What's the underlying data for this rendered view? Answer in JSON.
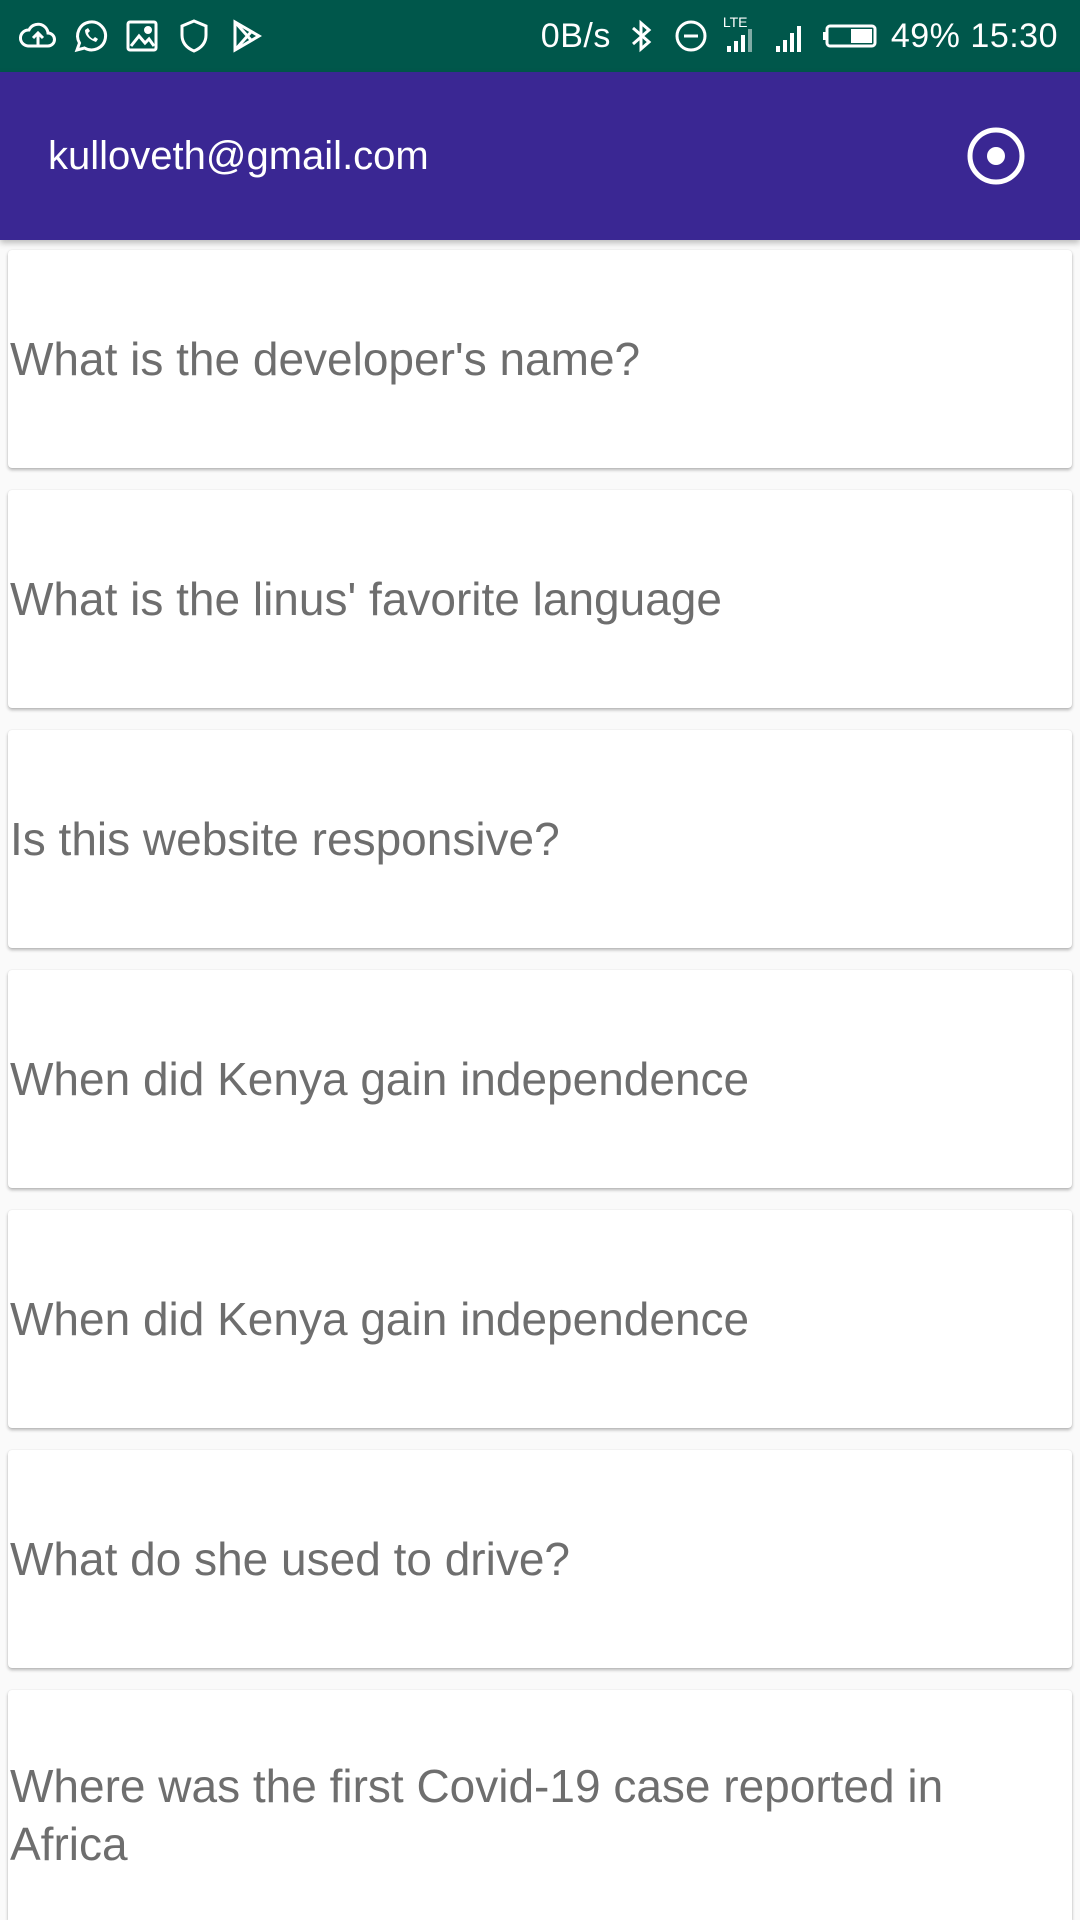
{
  "status_bar": {
    "icons_left": [
      "cloud-upload-icon",
      "whatsapp-icon",
      "image-icon",
      "shield-icon",
      "play-store-icon"
    ],
    "speed": "0B/s",
    "network_type": "LTE",
    "battery": "49%",
    "time": "15:30",
    "icons_right": [
      "bluetooth-icon",
      "do-not-disturb-icon",
      "lte-signal-icon",
      "signal-icon",
      "battery-icon"
    ]
  },
  "app_bar": {
    "title": "kulloveth@gmail.com",
    "action_icon": "record-icon"
  },
  "questions": [
    "What is the developer's name?",
    "What is the linus' favorite language",
    "Is this website responsive?",
    "When did Kenya gain independence",
    "When did Kenya gain independence",
    "What do she used to drive?",
    "Where was the first Covid-19 case reported in Africa"
  ],
  "colors": {
    "status_bar": "#00574b",
    "app_bar": "#3a2793",
    "card_text": "#6e6e6e",
    "background": "#fafafa"
  }
}
